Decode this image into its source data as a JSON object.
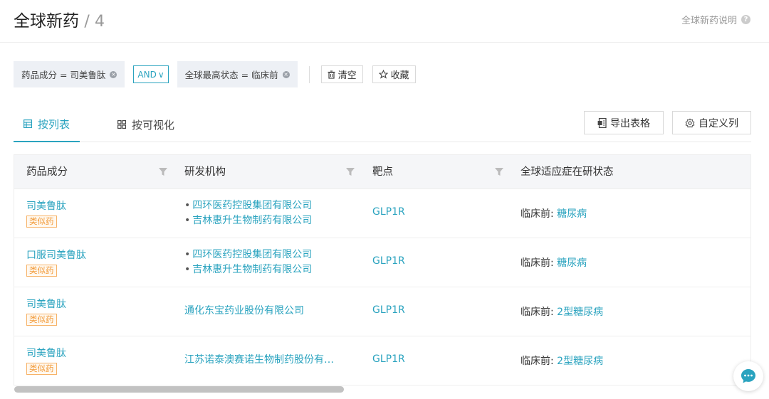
{
  "header": {
    "title": "全球新药",
    "separator": "/",
    "count": "4",
    "help_text": "全球新药说明",
    "help_icon_char": "?"
  },
  "filters": {
    "chips": [
      {
        "label": "药品成分 = 司美鲁肽"
      },
      {
        "label": "全球最高状态 = 临床前"
      }
    ],
    "operator": "AND",
    "operator_arrow": "∨",
    "clear_label": "清空",
    "favorite_label": "收藏",
    "remove_char": "×"
  },
  "tabs": {
    "list_label": "按列表",
    "visual_label": "按可视化"
  },
  "toolbar": {
    "export_label": "导出表格",
    "custom_columns_label": "自定义列"
  },
  "table": {
    "columns": [
      "药品成分",
      "研发机构",
      "靶点",
      "全球适应症在研状态"
    ],
    "rows": [
      {
        "drug": "司美鲁肽",
        "tag": "类似药",
        "orgs": [
          "四环医药控股集团有限公司",
          "吉林惠升生物制药有限公司"
        ],
        "target": "GLP1R",
        "status_label": "临床前:",
        "indication": "糖尿病"
      },
      {
        "drug": "口服司美鲁肽",
        "tag": "类似药",
        "orgs": [
          "四环医药控股集团有限公司",
          "吉林惠升生物制药有限公司"
        ],
        "target": "GLP1R",
        "status_label": "临床前:",
        "indication": "糖尿病"
      },
      {
        "drug": "司美鲁肽",
        "tag": "类似药",
        "orgs": [
          "通化东宝药业股份有限公司"
        ],
        "target": "GLP1R",
        "status_label": "临床前:",
        "indication": "2型糖尿病"
      },
      {
        "drug": "司美鲁肽",
        "tag": "类似药",
        "orgs": [
          "江苏诺泰澳赛诺生物制药股份有…"
        ],
        "target": "GLP1R",
        "status_label": "临床前:",
        "indication": "2型糖尿病"
      }
    ]
  },
  "colors": {
    "accent": "#2aa3bf",
    "tag_orange": "#f29a38"
  },
  "icons": [
    "help-icon",
    "remove-icon",
    "chevron-down-icon",
    "trash-icon",
    "star-icon",
    "table-icon",
    "grid-icon",
    "export-icon",
    "gear-icon",
    "filter-icon",
    "chat-icon"
  ]
}
